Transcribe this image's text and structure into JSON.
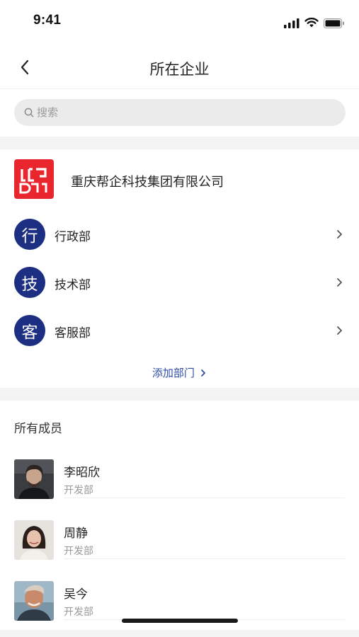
{
  "status": {
    "time": "9:41"
  },
  "nav": {
    "title": "所在企业"
  },
  "search": {
    "placeholder": "搜索"
  },
  "company": {
    "name": "重庆帮企科技集团有限公司",
    "logo_color": "#e9262e"
  },
  "departments": [
    {
      "avatar_char": "行",
      "label": "行政部"
    },
    {
      "avatar_char": "技",
      "label": "技术部"
    },
    {
      "avatar_char": "客",
      "label": "客服部"
    }
  ],
  "add_department": "添加部门",
  "members_section": {
    "title": "所有成员"
  },
  "members": [
    {
      "name": "李昭欣",
      "dept": "开发部"
    },
    {
      "name": "周静",
      "dept": "开发部"
    },
    {
      "name": "吴今",
      "dept": "开发部"
    }
  ],
  "colors": {
    "accent": "#1d2f82",
    "link": "#2f4ba8",
    "background_gap": "#f4f4f4"
  }
}
